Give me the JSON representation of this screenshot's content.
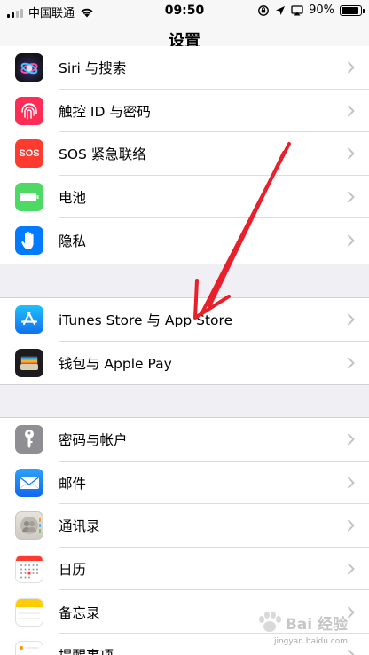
{
  "status_bar": {
    "carrier": "中国联通",
    "time": "09:50",
    "battery": "90%"
  },
  "nav": {
    "title": "设置"
  },
  "groups": [
    {
      "items": [
        {
          "label": "Siri 与搜索",
          "icon": "siri-icon",
          "color": "#1c1c1e"
        },
        {
          "label": "触控 ID 与密码",
          "icon": "fingerprint-icon",
          "color": "#ff2d55"
        },
        {
          "label": "SOS 紧急联络",
          "icon": "sos-icon",
          "color": "#ff3b30",
          "icon_text": "SOS"
        },
        {
          "label": "电池",
          "icon": "battery-icon",
          "color": "#4cd964"
        },
        {
          "label": "隐私",
          "icon": "hand-icon",
          "color": "#007aff"
        }
      ]
    },
    {
      "items": [
        {
          "label": "iTunes Store 与 App Store",
          "icon": "app-store-icon",
          "color": "#1a8cf7"
        },
        {
          "label": "钱包与 Apple Pay",
          "icon": "wallet-icon",
          "color": "#1c1c1e"
        }
      ]
    },
    {
      "items": [
        {
          "label": "密码与帐户",
          "icon": "key-icon",
          "color": "#8e8e93"
        },
        {
          "label": "邮件",
          "icon": "mail-icon",
          "color": "#1a8cf7"
        },
        {
          "label": "通讯录",
          "icon": "contacts-icon",
          "color": "#d9d6d0"
        },
        {
          "label": "日历",
          "icon": "calendar-icon",
          "color": "#ffffff"
        },
        {
          "label": "备忘录",
          "icon": "notes-icon",
          "color": "#ffcc00"
        },
        {
          "label": "提醒事项",
          "icon": "reminders-icon",
          "color": "#ffffff"
        }
      ]
    }
  ],
  "watermark": {
    "text": "Bai 经验",
    "sub": "jingyan.baidu.com"
  },
  "annotation": {
    "color": "#e8202b"
  }
}
